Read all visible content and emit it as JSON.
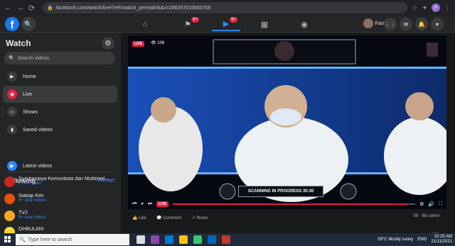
{
  "browser": {
    "url": "facebook.com/watch/live/?ref=watch_permalink&v=286397016583708",
    "profile_initial": "F"
  },
  "topnav": {
    "logo": "f",
    "tabs": [
      {
        "name": "home",
        "badge": ""
      },
      {
        "name": "pages",
        "badge": "9+"
      },
      {
        "name": "watch",
        "badge": "9+"
      },
      {
        "name": "marketplace",
        "badge": ""
      },
      {
        "name": "gaming",
        "badge": ""
      }
    ],
    "account_name": "Fara"
  },
  "sidebar": {
    "title": "Watch",
    "search_placeholder": "Search videos",
    "items": [
      {
        "label": "Home"
      },
      {
        "label": "Live"
      },
      {
        "label": "Shows"
      },
      {
        "label": "Saved videos"
      }
    ],
    "following_label": "Following",
    "manage_label": "Manage",
    "latest_label": "Latest videos",
    "following": [
      {
        "name": "Suruhanjaya Komunikasi dan Multimed...",
        "sub": "1 new video",
        "color": "#c62828"
      },
      {
        "name": "Siakap Keli",
        "sub": "9+ new videos",
        "color": "#e65100"
      },
      {
        "name": "TV2",
        "sub": "9+ new videos",
        "color": "#f9a825"
      },
      {
        "name": "OHBULAN!",
        "sub": "",
        "color": "#fdd835"
      }
    ]
  },
  "video": {
    "live_label": "LIVE",
    "viewers": "106",
    "caption": "SCANNING IN PROGRESS",
    "timestamp": "35:30",
    "progress": 0.97
  },
  "actions": {
    "like": "Like",
    "comment": "Comment",
    "share": "Share",
    "reactions": "59 · 68 comm"
  },
  "taskbar": {
    "search_placeholder": "Type here to search",
    "weather": "29°C  Mostly sunny",
    "lang": "ENG",
    "time": "10:20 AM",
    "date": "21/11/2021"
  }
}
